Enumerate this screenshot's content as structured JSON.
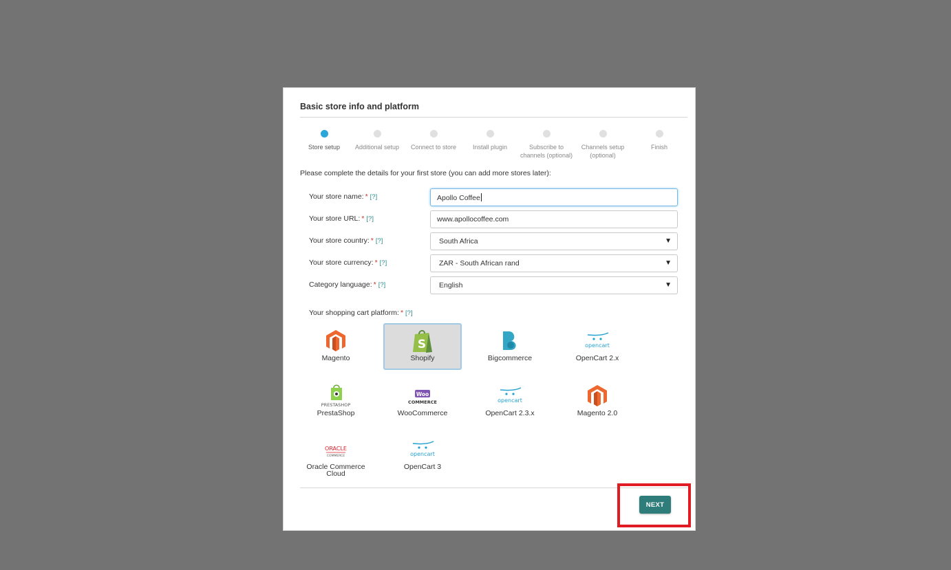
{
  "modal": {
    "title": "Basic store info and platform"
  },
  "steps": [
    {
      "label": "Store setup",
      "active": true
    },
    {
      "label": "Additional setup",
      "active": false
    },
    {
      "label": "Connect to store",
      "active": false
    },
    {
      "label": "Install plugin",
      "active": false
    },
    {
      "label": "Subscribe to channels (optional)",
      "active": false
    },
    {
      "label": "Channels setup (optional)",
      "active": false
    },
    {
      "label": "Finish",
      "active": false
    }
  ],
  "intro": "Please complete the details for your first store (you can add more stores later):",
  "form": {
    "required_mark": "*",
    "help_mark": "[?]",
    "store_name": {
      "label": "Your store name:",
      "value": "Apollo Coffee"
    },
    "store_url": {
      "label": "Your store URL:",
      "value": "www.apollocoffee.com"
    },
    "store_country": {
      "label": "Your store country:",
      "value": "South Africa"
    },
    "store_currency": {
      "label": "Your store currency:",
      "value": "ZAR - South African rand"
    },
    "category_language": {
      "label": "Category language:",
      "value": "English"
    },
    "select_arrow": "▼"
  },
  "platform": {
    "label": "Your shopping cart platform:",
    "selected": "Shopify",
    "options": [
      {
        "name": "Magento",
        "icon": "magento-icon"
      },
      {
        "name": "Shopify",
        "icon": "shopify-icon"
      },
      {
        "name": "Bigcommerce",
        "icon": "bigcommerce-icon"
      },
      {
        "name": "OpenCart 2.x",
        "icon": "opencart-icon"
      },
      {
        "name": "PrestaShop",
        "icon": "prestashop-icon"
      },
      {
        "name": "WooCommerce",
        "icon": "woocommerce-icon"
      },
      {
        "name": "OpenCart 2.3.x",
        "icon": "opencart-icon"
      },
      {
        "name": "Magento 2.0",
        "icon": "magento-icon"
      },
      {
        "name": "Oracle Commerce Cloud",
        "icon": "oracle-icon"
      },
      {
        "name": "OpenCart 3",
        "icon": "opencart-icon"
      }
    ],
    "logo_text": {
      "opencart": "opencart",
      "presta": "PRESTASHOP",
      "woo_top": "Woo",
      "woo_bottom": "COMMERCE",
      "oracle_top": "ORACLE",
      "oracle_bottom": "COMMERCE"
    }
  },
  "footer": {
    "next_label": "NEXT"
  },
  "colors": {
    "overlay": "#737373",
    "accent_step": "#2aa6d9",
    "button": "#2e7d7a",
    "highlight": "#e01b24"
  }
}
